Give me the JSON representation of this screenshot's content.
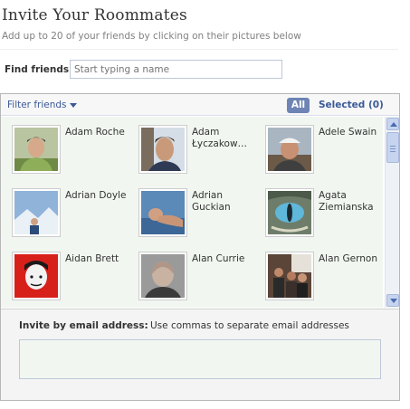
{
  "header": {
    "title": "Invite Your Roommates",
    "subtitle": "Add up to 20 of your friends by clicking on their pictures below"
  },
  "search": {
    "label": "Find friends",
    "placeholder": "Start typing a name",
    "value": ""
  },
  "filter_bar": {
    "filter_label": "Filter friends",
    "all_label": "All",
    "selected_label": "Selected (0)"
  },
  "friends": [
    {
      "name": "Adam Roche",
      "avatar": "man-green-shirt-portrait"
    },
    {
      "name": "Adam Łyczakow…",
      "avatar": "young-man-outdoor-portrait"
    },
    {
      "name": "Adele Swain",
      "avatar": "person-with-white-cap"
    },
    {
      "name": "Adrian Doyle",
      "avatar": "person-in-snow-landscape"
    },
    {
      "name": "Adrian Guckian",
      "avatar": "person-lying-on-bed"
    },
    {
      "name": "Agata Ziemianska",
      "avatar": "cat-eye-closeup"
    },
    {
      "name": "Aidan Brett",
      "avatar": "boy-red-background"
    },
    {
      "name": "Alan Currie",
      "avatar": "bald-man-portrait"
    },
    {
      "name": "Alan Gernon",
      "avatar": "group-at-party"
    }
  ],
  "email": {
    "label": "Invite by email address:",
    "hint": "Use commas to separate email addresses",
    "value": ""
  },
  "colors": {
    "link": "#3b5998",
    "all_button": "#6d84b4",
    "friends_background": "#f1f7f0",
    "input_border": "#bdc7d8"
  }
}
